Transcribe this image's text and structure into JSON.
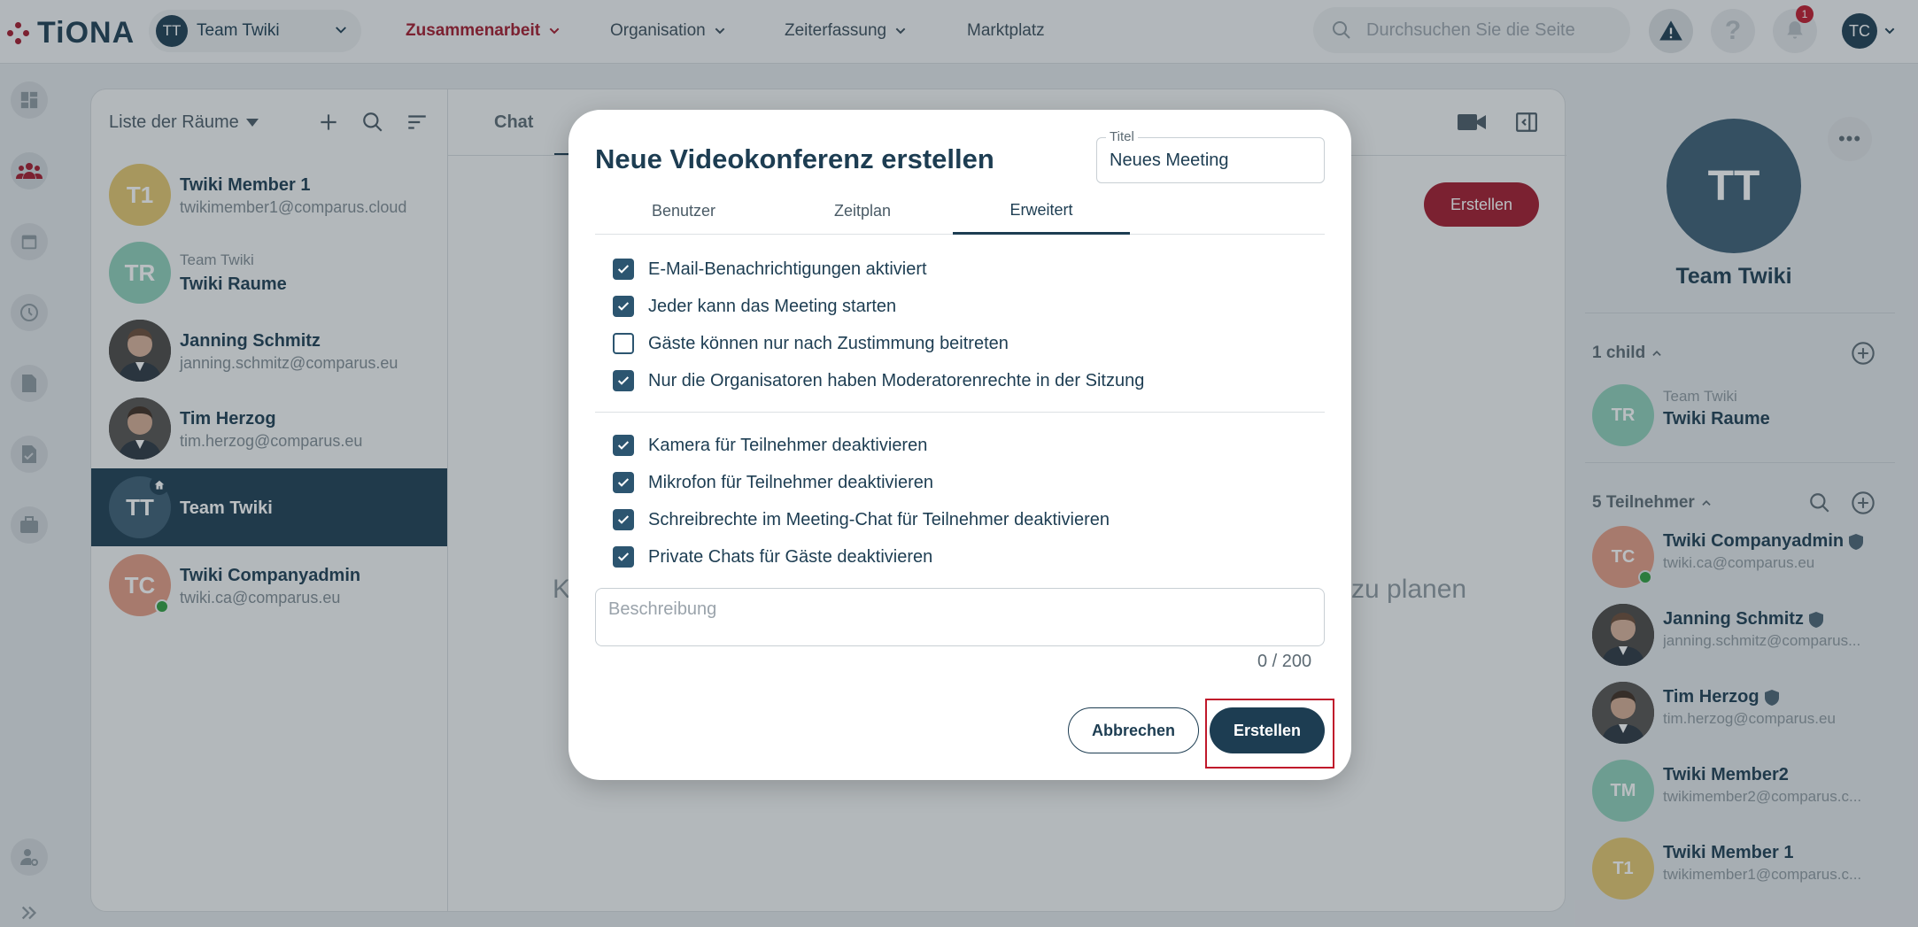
{
  "app": {
    "logo_text": "TiONA",
    "brand_color": "#a3182b",
    "primary_color": "#1d3d52"
  },
  "topbar": {
    "team_selector": {
      "avatar": "TT",
      "label": "Team Twiki"
    },
    "nav": [
      {
        "label": "Zusammenarbeit",
        "active": true
      },
      {
        "label": "Organisation"
      },
      {
        "label": "Zeiterfassung"
      },
      {
        "label": "Marktplatz"
      }
    ],
    "search_placeholder": "Durchsuchen Sie die Seite",
    "notification_count": "1",
    "user_initials": "TC"
  },
  "rail": [
    "dashboard-icon",
    "team-icon",
    "calendar-icon",
    "time-tracking-icon",
    "document-icon",
    "tasks-icon",
    "briefcase-icon",
    "user-settings-icon",
    "expand-icon"
  ],
  "rooms": {
    "title": "Liste der Räume",
    "items": [
      {
        "initials": "T1",
        "name": "Twiki Member 1",
        "sub": "twikimember1@comparus.cloud",
        "color": "#e3c66d"
      },
      {
        "initials": "TR",
        "small": "Team Twiki",
        "name": "Twiki Raume",
        "color": "#8ecfb8"
      },
      {
        "name": "Janning Schmitz",
        "sub": "janning.schmitz@comparus.eu"
      },
      {
        "name": "Tim Herzog",
        "sub": "tim.herzog@comparus.eu"
      },
      {
        "initials": "TT",
        "name": "Team Twiki",
        "selected": true,
        "color": "#3b5d73"
      },
      {
        "initials": "TC",
        "name": "Twiki Companyadmin",
        "sub": "twiki.ca@comparus.eu",
        "color": "#e49b83",
        "online": true
      }
    ]
  },
  "chat": {
    "tab": "Chat",
    "create_label": "Erstellen",
    "empty_left": "K",
    "empty_right": "zu planen"
  },
  "right_panel": {
    "initials": "TT",
    "title": "Team Twiki",
    "child_section": "1 child",
    "child": {
      "initials": "TR",
      "small": "Team Twiki",
      "name": "Twiki Raume"
    },
    "members_section": "5 Teilnehmer",
    "members": [
      {
        "initials": "TC",
        "name": "Twiki Companyadmin",
        "email": "twiki.ca@comparus.eu",
        "color": "#e49b83",
        "shield": true,
        "online": true
      },
      {
        "name": "Janning Schmitz",
        "email": "janning.schmitz@comparus...",
        "shield": true
      },
      {
        "name": "Tim Herzog",
        "email": "tim.herzog@comparus.eu",
        "shield": true
      },
      {
        "initials": "TM",
        "name": "Twiki Member2",
        "email": "twikimember2@comparus.c...",
        "color": "#8ecfb8"
      },
      {
        "initials": "T1",
        "name": "Twiki Member 1",
        "email": "twikimember1@comparus.c...",
        "color": "#e3c66d"
      }
    ]
  },
  "modal": {
    "title": "Neue Videokonferenz erstellen",
    "title_field_label": "Titel",
    "title_field_value": "Neues Meeting",
    "tabs": [
      {
        "label": "Benutzer"
      },
      {
        "label": "Zeitplan"
      },
      {
        "label": "Erweitert",
        "active": true
      }
    ],
    "options_group1": [
      {
        "label": "E-Mail-Benachrichtigungen aktiviert",
        "checked": true
      },
      {
        "label": "Jeder kann das Meeting starten",
        "checked": true
      },
      {
        "label": "Gäste können nur nach Zustimmung beitreten",
        "checked": false
      },
      {
        "label": "Nur die Organisatoren haben Moderatorenrechte in der Sitzung",
        "checked": true
      }
    ],
    "options_group2": [
      {
        "label": "Kamera für Teilnehmer deaktivieren",
        "checked": true
      },
      {
        "label": "Mikrofon für Teilnehmer deaktivieren",
        "checked": true
      },
      {
        "label": "Schreibrechte im Meeting-Chat für Teilnehmer deaktivieren",
        "checked": true
      },
      {
        "label": "Private Chats für Gäste deaktivieren",
        "checked": true
      }
    ],
    "description_placeholder": "Beschreibung",
    "counter": "0 / 200",
    "cancel_label": "Abbrechen",
    "create_label": "Erstellen"
  }
}
